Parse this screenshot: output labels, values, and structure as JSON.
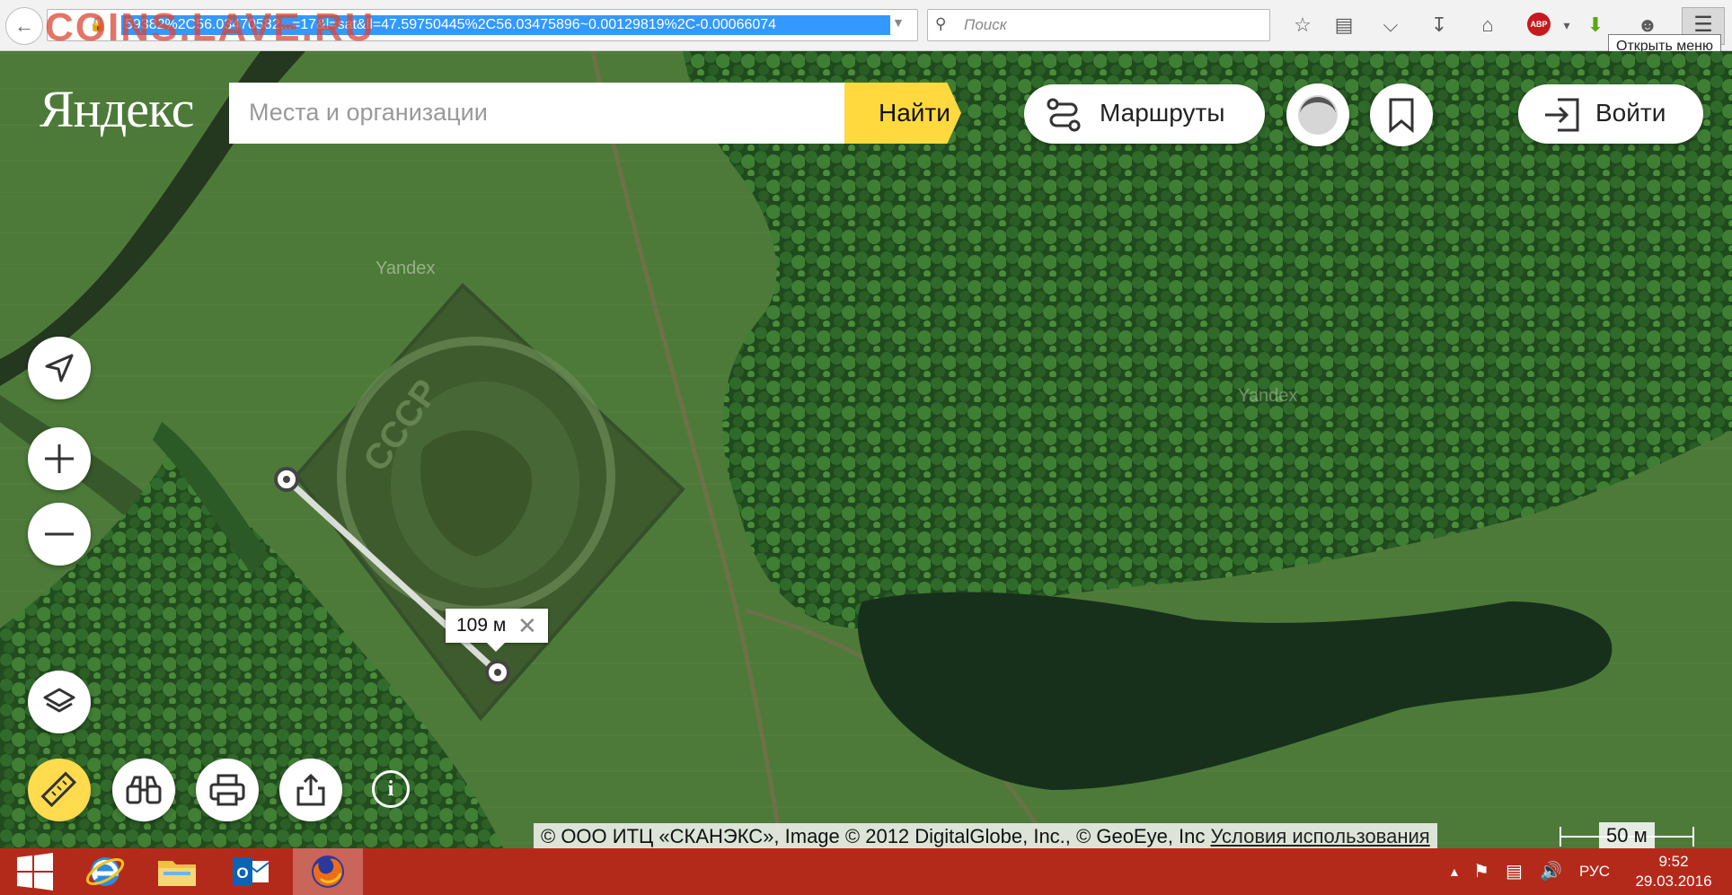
{
  "browser": {
    "url": "59382%2C56.03470582...=17&l=sat&ll=47.59750445%2C56.03475896~0.00129819%2C-0.00066074",
    "search_placeholder": "Поиск",
    "tooltip": "Открыть меню",
    "abp_label": "ABP",
    "watermark": "COINS.LAVE.RU"
  },
  "yandex": {
    "logo": "Яндекс",
    "search_placeholder": "Места и организации",
    "find_label": "Найти",
    "routes_label": "Маршруты",
    "login_label": "Войти"
  },
  "map": {
    "watermark_text": "Yandex",
    "measure_label": "109 м",
    "scale_label": "50 м",
    "copyright": "© ООО ИТЦ «СКАНЭКС», Image © 2012 DigitalGlobe, Inc., © GeoEye, Inc",
    "terms_link": "Условия использования",
    "crop_text": "СССР"
  },
  "taskbar": {
    "lang": "РУС",
    "time": "9:52",
    "date": "29.03.2016"
  },
  "colors": {
    "yandex_yellow": "#ffd93d",
    "taskbar_red": "#b42a1a",
    "url_selection": "#3399ff"
  }
}
